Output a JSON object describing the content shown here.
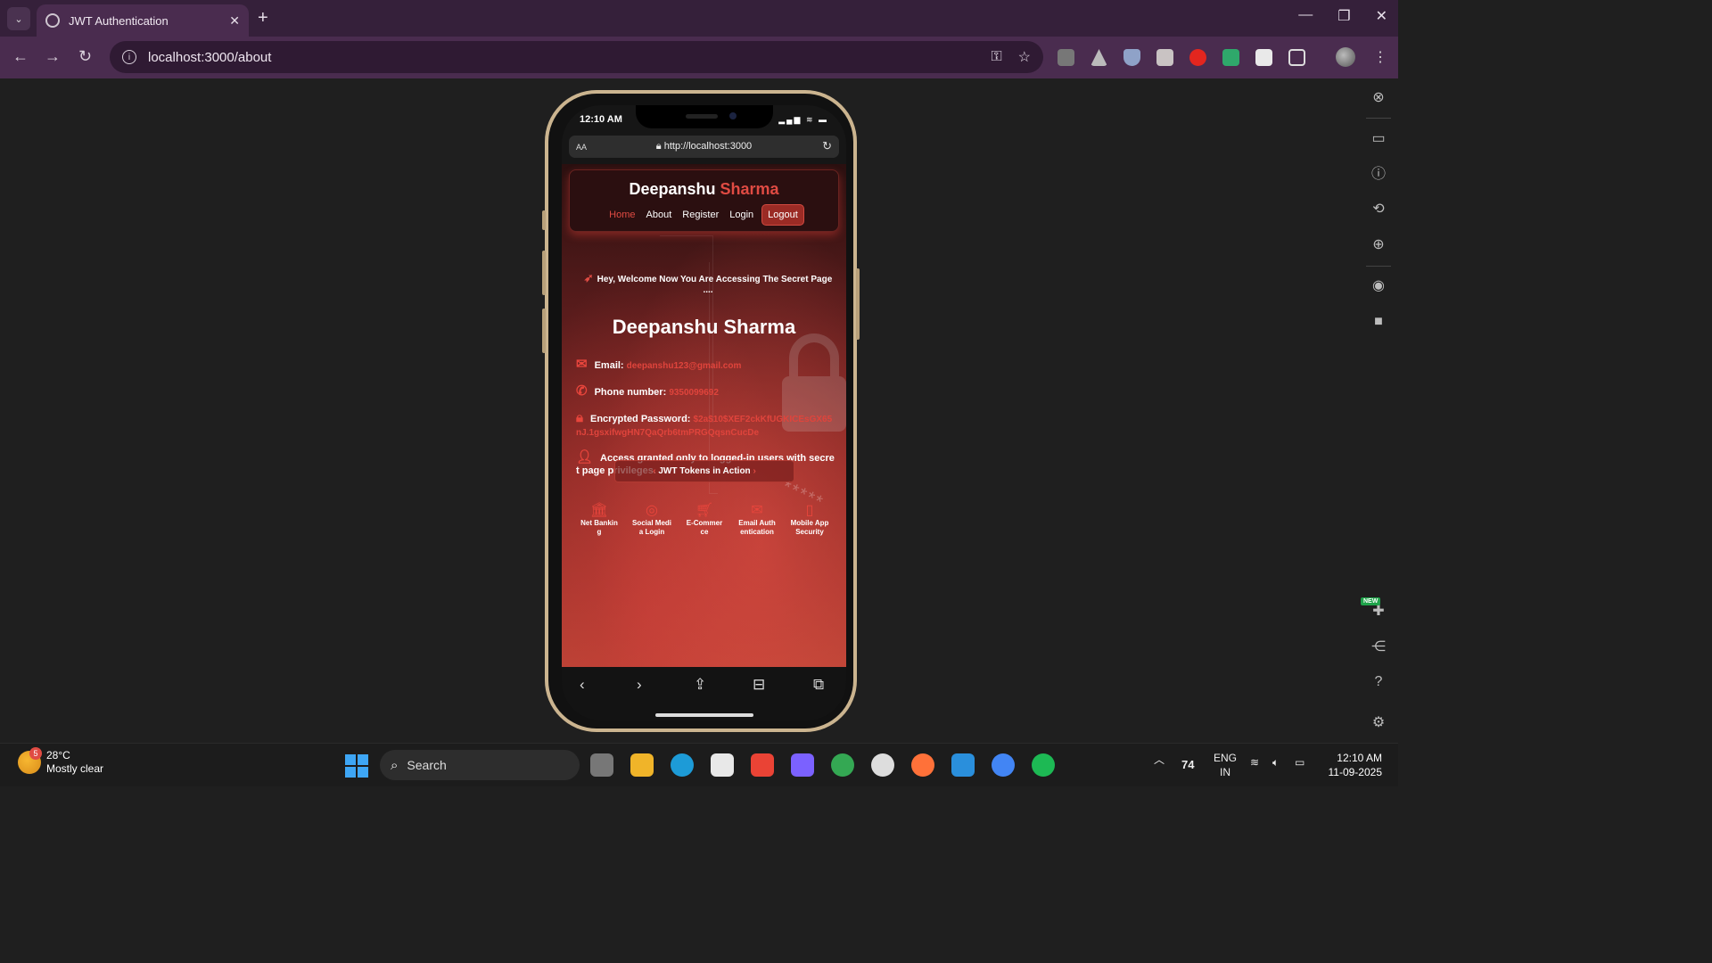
{
  "browser": {
    "tab_title": "JWT Authentication",
    "tab_close": "✕",
    "new_tab": "+",
    "url": "localhost:3000/about"
  },
  "phone": {
    "status_time": "12:10 AM",
    "safari_aa": "AA",
    "safari_url": "http://localhost:3000"
  },
  "site": {
    "brand_first": "Deepanshu",
    "brand_last": "Sharma",
    "nav": {
      "home": "Home",
      "about": "About",
      "register": "Register",
      "login": "Login",
      "logout": "Logout"
    },
    "welcome": "Hey, Welcome Now You Are Accessing The Secret Page ....",
    "person_name": "Deepanshu Sharma",
    "email_label": "Email:",
    "email_value": "deepanshu123@gmail.com",
    "phone_label": "Phone number:",
    "phone_value": "9350099692",
    "password_label": "Encrypted Password:",
    "password_value": "$2a$10$XEF2ckKfUGKICEsGX65nJ.1gsxifwgHN7QaQrb6tmPRGQqsnCucDe",
    "access_text": "Access granted only to logged-in users with secret page privileges.",
    "jwt_button": "JWT Tokens in Action",
    "features": [
      {
        "label": "Net Banking",
        "icon": "bank-icon"
      },
      {
        "label": "Social Media Login",
        "icon": "instagram-icon"
      },
      {
        "label": "E-Commerce",
        "icon": "cart-icon"
      },
      {
        "label": "Email Authentication",
        "icon": "envelope-icon"
      },
      {
        "label": "Mobile App Security",
        "icon": "mobile-icon"
      }
    ]
  },
  "taskbar": {
    "weather_temp": "28°C",
    "weather_desc": "Mostly clear",
    "weather_badge": "5",
    "search_label": "Search",
    "tray_number": "74",
    "lang_top": "ENG",
    "lang_bottom": "IN",
    "time": "12:10 AM",
    "date": "11-09-2025"
  },
  "colors": {
    "accent": "#e04b43",
    "tab_bg": "#4a2c4f",
    "tabbar_bg": "#35203a"
  }
}
